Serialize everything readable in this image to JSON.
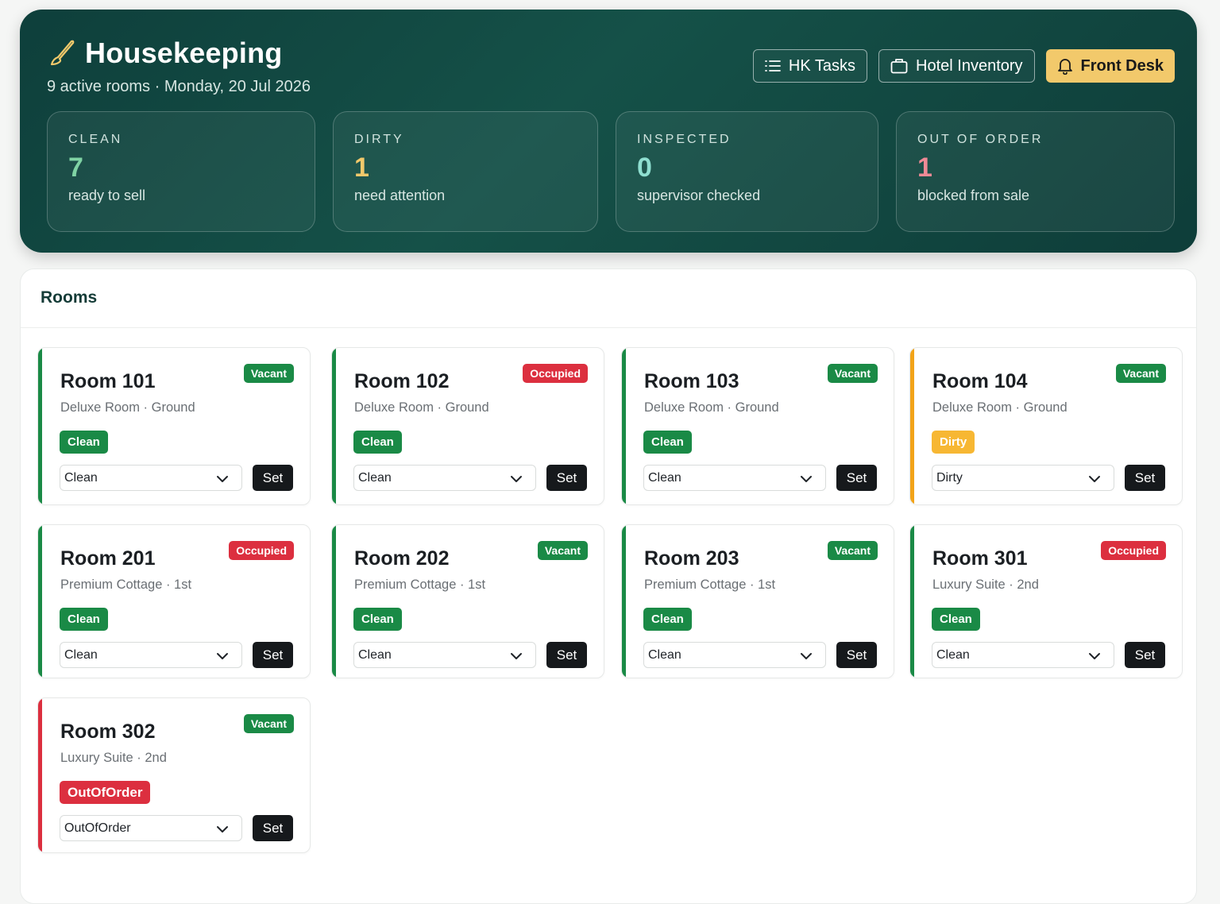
{
  "header": {
    "title": "Housekeeping",
    "subtitle": "9 active rooms · Monday, 20 Jul 2026",
    "actions": [
      {
        "label": "HK Tasks",
        "icon": "list-icon"
      },
      {
        "label": "Hotel Inventory",
        "icon": "bag-icon"
      },
      {
        "label": "Front Desk",
        "icon": "bell-icon"
      }
    ]
  },
  "stats": [
    {
      "label": "CLEAN",
      "value": "7",
      "desc": "ready to sell",
      "color": "#7fd3a4"
    },
    {
      "label": "DIRTY",
      "value": "1",
      "desc": "need attention",
      "color": "#f2c96b"
    },
    {
      "label": "INSPECTED",
      "value": "0",
      "desc": "supervisor checked",
      "color": "#8fdfd0"
    },
    {
      "label": "OUT OF ORDER",
      "value": "1",
      "desc": "blocked from sale",
      "color": "#f08a96"
    }
  ],
  "rooms_panel": {
    "title": "Rooms"
  },
  "colors": {
    "green": "#1a8a46",
    "red": "#dc2f3f",
    "orange": "#f2a318",
    "dirty_badge": "#f7b733"
  },
  "rooms": [
    {
      "name": "Room 101",
      "meta": "Deluxe Room · Ground",
      "occupancy": "Vacant",
      "status": "Clean",
      "select": "Clean",
      "set": "Set"
    },
    {
      "name": "Room 102",
      "meta": "Deluxe Room · Ground",
      "occupancy": "Occupied",
      "status": "Clean",
      "select": "Clean",
      "set": "Set"
    },
    {
      "name": "Room 103",
      "meta": "Deluxe Room · Ground",
      "occupancy": "Vacant",
      "status": "Clean",
      "select": "Clean",
      "set": "Set"
    },
    {
      "name": "Room 104",
      "meta": "Deluxe Room · Ground",
      "occupancy": "Vacant",
      "status": "Dirty",
      "select": "Dirty",
      "set": "Set"
    },
    {
      "name": "Room 201",
      "meta": "Premium Cottage · 1st",
      "occupancy": "Occupied",
      "status": "Clean",
      "select": "Clean",
      "set": "Set"
    },
    {
      "name": "Room 202",
      "meta": "Premium Cottage · 1st",
      "occupancy": "Vacant",
      "status": "Clean",
      "select": "Clean",
      "set": "Set"
    },
    {
      "name": "Room 203",
      "meta": "Premium Cottage · 1st",
      "occupancy": "Vacant",
      "status": "Clean",
      "select": "Clean",
      "set": "Set"
    },
    {
      "name": "Room 301",
      "meta": "Luxury Suite · 2nd",
      "occupancy": "Occupied",
      "status": "Clean",
      "select": "Clean",
      "set": "Set"
    },
    {
      "name": "Room 302",
      "meta": "Luxury Suite · 2nd",
      "occupancy": "Vacant",
      "status": "OutOfOrder",
      "select": "OutOfOrder",
      "set": "Set"
    }
  ]
}
